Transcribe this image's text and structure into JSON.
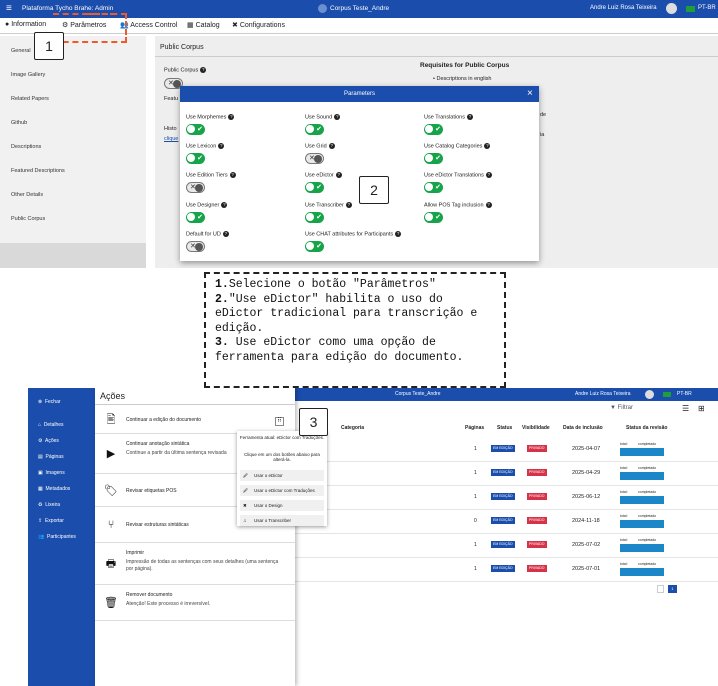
{
  "top": {
    "brand": "Plataforma Tycho Brahe: Admin",
    "corpus": "Corpus Teste_Andre",
    "user": "Andre Luiz Rosa Teixeira",
    "lang": "PT-BR",
    "menu": [
      "Information",
      "Parâmetros",
      "Access Control",
      "Catalog",
      "Configurations"
    ],
    "sidebar": [
      "General",
      "Image Gallery",
      "Related Papers",
      "Github",
      "Descriptions",
      "Featured Descriptions",
      "Other Details",
      "Public Corpus"
    ],
    "section_title": "Public Corpus",
    "public_corpus_label": "Public Corpus",
    "featured_label": "Featu",
    "history_label": "Histo",
    "clique_label": "clique",
    "requisites_title": "Requisites for Public Corpus",
    "requisites_item": "Descriptions in english",
    "right_frag_1": "de",
    "right_frag_2": "ia"
  },
  "modal": {
    "title": "Parameters",
    "close": "×",
    "params": [
      {
        "label": "Use Morphemes",
        "on": true
      },
      {
        "label": "Use Sound",
        "on": true
      },
      {
        "label": "Use Translations",
        "on": true
      },
      {
        "label": "Use Lexicon",
        "on": true
      },
      {
        "label": "Use Grid",
        "on": false
      },
      {
        "label": "Use Catalog Categories",
        "on": true
      },
      {
        "label": "Use Edition Tiers",
        "on": false
      },
      {
        "label": "Use eDictor",
        "on": true
      },
      {
        "label": "Use eDictor Translations",
        "on": true
      },
      {
        "label": "Use Designer",
        "on": true
      },
      {
        "label": "Use Transcriber",
        "on": true
      },
      {
        "label": "Allow POS Tag inclusion",
        "on": true
      },
      {
        "label": "Default for UD",
        "on": false
      },
      {
        "label": "Use CHAT attributes for Participants",
        "on": true
      }
    ]
  },
  "callouts": {
    "one": "1",
    "two": "2",
    "three": "3"
  },
  "instructions": [
    {
      "num": "1.",
      "text": "Selecione o botão \"Parâmetros\""
    },
    {
      "num": "2.",
      "text": "\"Use eDictor\" habilita o uso do eDictor tradicional para transcrição e edição."
    },
    {
      "num": "3.",
      "text": " Use eDictor como uma opção de ferramenta para edição do documento."
    }
  ],
  "bottom": {
    "sidebar": [
      "Fechar",
      "Detalhes",
      "Ações",
      "Páginas",
      "Imagens",
      "Metadados",
      "Lixeira",
      "Exportar",
      "Participantes"
    ],
    "corpus": "Corpus Teste_Andre",
    "user": "Andre Luiz Rosa Teixeira",
    "lang": "PT-BR",
    "filter": "Filtrar",
    "acoes_title": "Ações",
    "actions": [
      {
        "title": "Continuar a edição do documento",
        "sub": ""
      },
      {
        "title": "Continuar anotação sintática",
        "sub": "Continue a partir da última sentença revisada"
      },
      {
        "title": "Revisar etiquetas POS",
        "sub": ""
      },
      {
        "title": "Revisar estruturas sintáticas",
        "sub": ""
      },
      {
        "title": "Imprimir",
        "sub": "Impressão de todas as sentenças com seus detalhes (uma sentença por página)."
      },
      {
        "title": "Remover documento",
        "sub": "Atenção! Este processo é irreversível."
      }
    ],
    "popup": {
      "head": "Ferramenta atual: eDictor com Traduções.",
      "note": "Clique em um dos botões abaixo para alterá-la.",
      "options": [
        "Usar o eDictor",
        "Usar o eDictor com Traduções",
        "Usar o Design",
        "Usar o Transcriber"
      ]
    },
    "table_headers": [
      "Categoria",
      "Páginas",
      "Status",
      "Visibilidade",
      "Data de inclusão",
      "Status da revisão"
    ],
    "rows": [
      {
        "pages": "1",
        "date": "2025-04-07"
      },
      {
        "pages": "1",
        "date": "2025-04-29"
      },
      {
        "pages": "1",
        "date": "2025-06-12"
      },
      {
        "pages": "0",
        "date": "2024-11-18"
      },
      {
        "pages": "1",
        "date": "2025-07-02"
      },
      {
        "pages": "1",
        "date": "2025-07-01"
      }
    ],
    "status_badge": "EM EDIÇÃO",
    "vis_badge": "PRIVADO",
    "rev_total": "total:",
    "rev_done": "completado",
    "page_num": "1"
  }
}
